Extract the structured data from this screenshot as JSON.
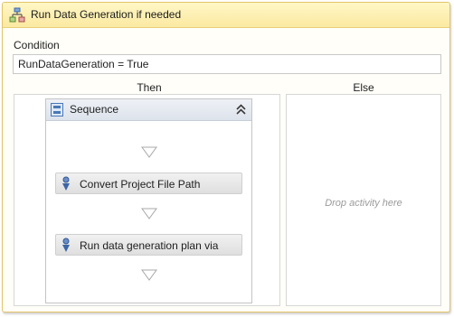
{
  "activity": {
    "title": "Run Data Generation if needed",
    "icon": "if-activity-icon"
  },
  "condition": {
    "label": "Condition",
    "value": "RunDataGeneration = True"
  },
  "branches": {
    "then_label": "Then",
    "else_label": "Else",
    "else_placeholder": "Drop activity here"
  },
  "sequence": {
    "title": "Sequence",
    "icon": "sequence-icon",
    "collapse_icon": "collapse-chevrons-icon",
    "activities": [
      {
        "label": "Convert Project File Path",
        "icon": "build-activity-icon"
      },
      {
        "label": "Run data generation plan via",
        "icon": "build-activity-icon"
      }
    ]
  },
  "colors": {
    "header_bg": "#fbe9a1",
    "frame_border": "#e3c46a",
    "placeholder_text": "#9b9b9b"
  }
}
